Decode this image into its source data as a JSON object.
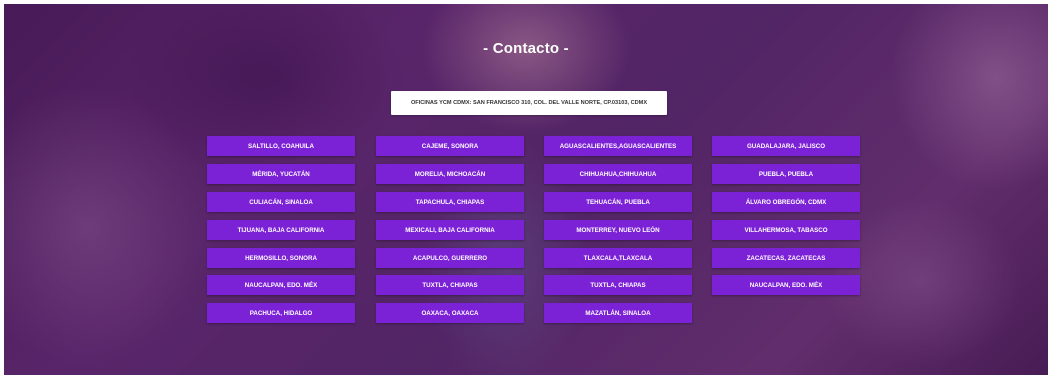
{
  "title": "- Contacto -",
  "address": "OFICINAS YCM CDMX: SAN FRANCISCO 310, COL. DEL VALLE NORTE, CP.03103, CDMX",
  "columns": [
    [
      "SALTILLO, COAHUILA",
      "MÉRIDA, YUCATÁN",
      "CULIACÁN, SINALOA",
      "TIJUANA, BAJA CALIFORNIA",
      "HERMOSILLO, SONORA",
      "NAUCALPAN, EDO. MÉX",
      "PACHUCA, HIDALGO"
    ],
    [
      "CAJEME, SONORA",
      "MORELIA, MICHOACÁN",
      "TAPACHULA, CHIAPAS",
      "MEXICALI, BAJA CALIFORNIA",
      "ACAPULCO, GUERRERO",
      "TUXTLA, CHIAPAS",
      "OAXACA, OAXACA"
    ],
    [
      "AGUASCALIENTES,AGUASCALIENTES",
      "CHIHUAHUA,CHIHUAHUA",
      "TEHUACÁN, PUEBLA",
      "MONTERREY, NUEVO LEÓN",
      "TLAXCALA,TLAXCALA",
      "TUXTLA, CHIAPAS",
      "MAZATLÁN, SINALOA"
    ],
    [
      "GUADALAJARA, JALISCO",
      "PUEBLA, PUEBLA",
      "ÁLVARO OBREGÓN, CDMX",
      "VILLAHERMOSA, TABASCO",
      "ZACATECAS, ZACATECAS",
      "NAUCALPAN, EDO. MÉX"
    ]
  ],
  "colors": {
    "button": "#7c22d6",
    "overlay": "#581e6e"
  }
}
